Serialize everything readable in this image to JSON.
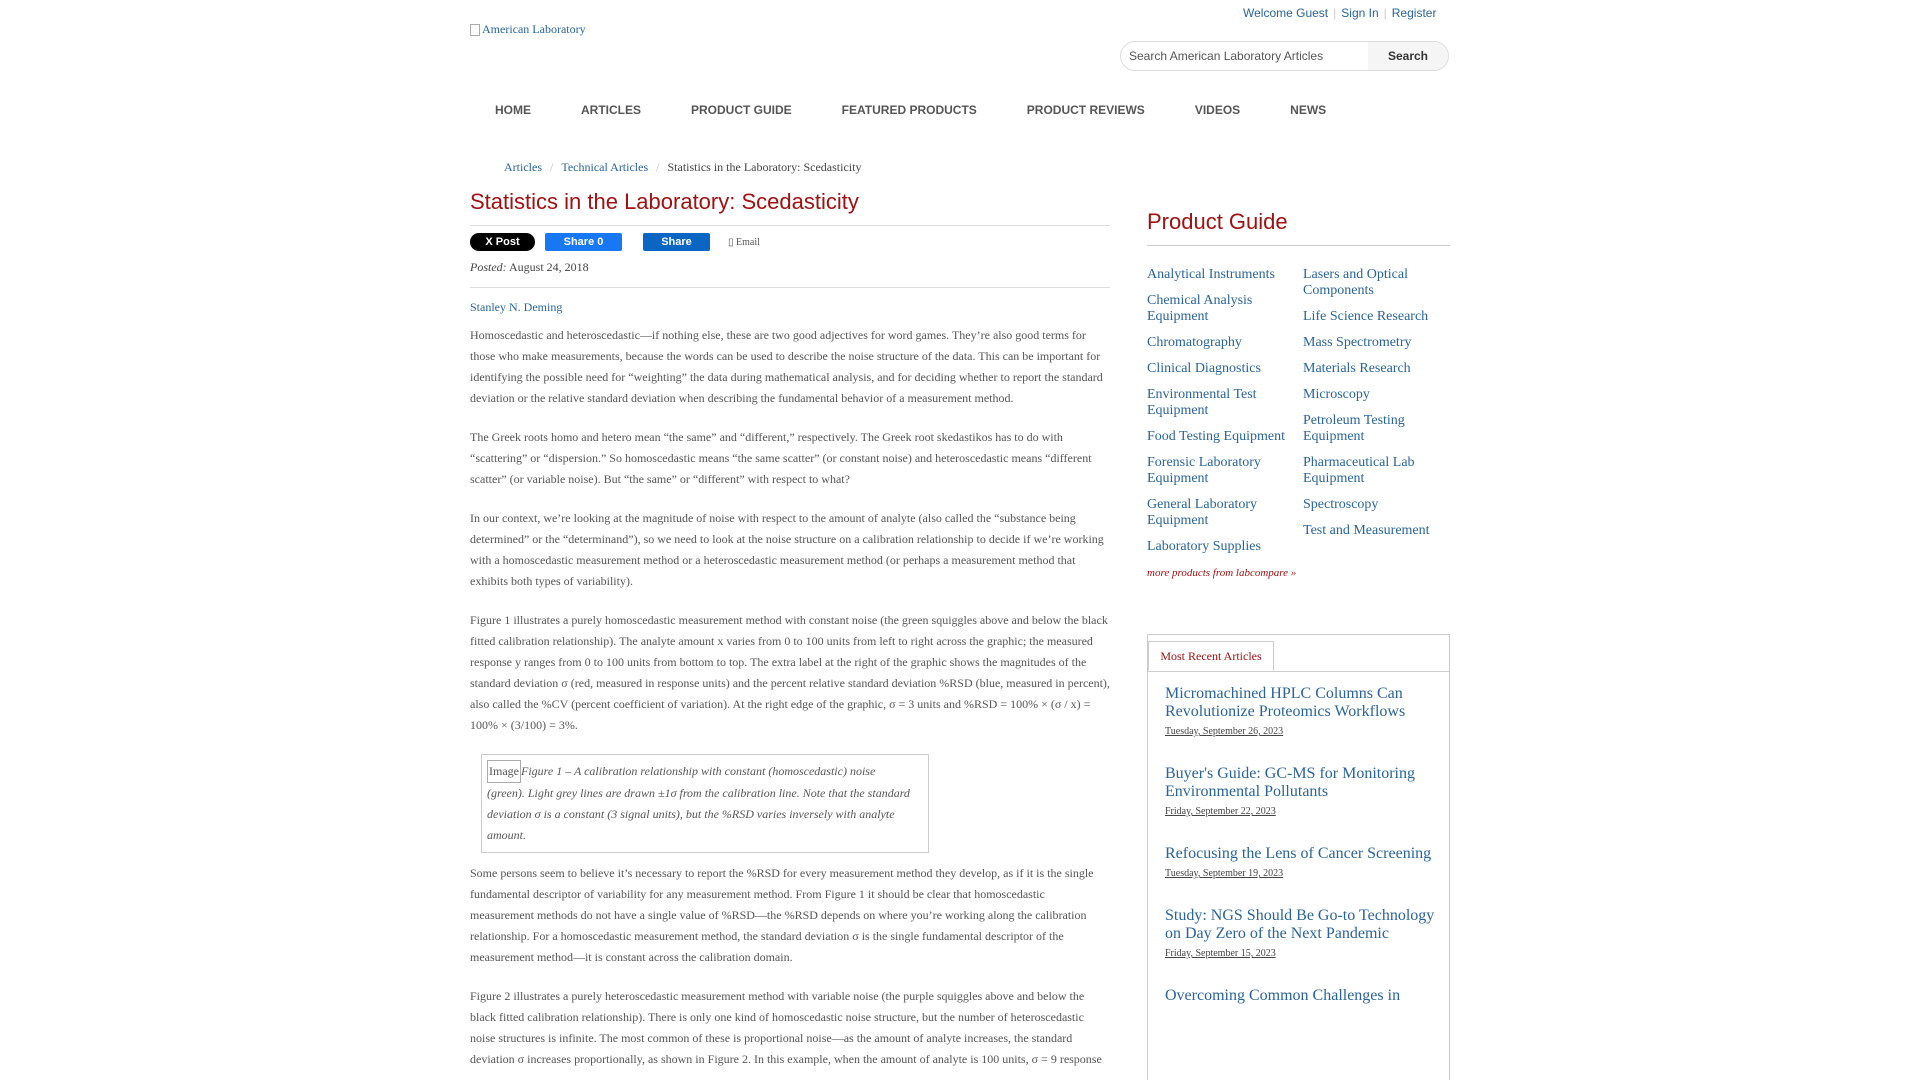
{
  "topbar": {
    "welcome": "Welcome Guest",
    "signin": "Sign In",
    "register": "Register"
  },
  "logo": {
    "alt": "American Laboratory"
  },
  "search": {
    "placeholder": "Search American Laboratory Articles",
    "button": "Search"
  },
  "nav": [
    "HOME",
    "ARTICLES",
    "PRODUCT GUIDE",
    "FEATURED PRODUCTS",
    "PRODUCT REVIEWS",
    "VIDEOS",
    "NEWS"
  ],
  "breadcrumb": {
    "items": [
      "Articles",
      "Technical Articles"
    ],
    "current": "Statistics in the Laboratory: Scedasticity"
  },
  "article": {
    "title": "Statistics in the Laboratory: Scedasticity",
    "share": {
      "x": "X Post",
      "fb": "Share 0",
      "linkedin": "Share",
      "email": "Email"
    },
    "posted_label": "Posted:",
    "posted_date": "August 24, 2018",
    "author": "Stanley N. Deming",
    "paragraphs": [
      "Homoscedastic and heteroscedastic—if nothing else, these are two good adjectives for word games. They’re also good terms for those who make measurements, because the words can be used to describe the noise structure of the data. This can be important for identifying the possible need for “weighting” the data during mathematical analysis, and for deciding whether to report the standard deviation or the relative standard deviation when describing the fundamental behavior of a measurement method.",
      "The Greek roots homo and hetero mean “the same” and “different,” respectively. The Greek root skedastikos has to do with “scattering” or “dispersion.” So homoscedastic means “the same scatter” (or constant noise) and heteroscedastic means “different scatter” (or variable noise). But “the same” or “different” with respect to what?",
      "In our context, we’re looking at the magnitude of noise with respect to the amount of analyte (also called the “substance being determined” or the “determinand”), so we need to look at the noise structure on a calibration relationship to decide if we’re working with a homoscedastic measurement method or a heteroscedastic measurement method (or perhaps a measurement method that exhibits both types of variability).",
      "Figure 1 illustrates a purely homoscedastic measurement method with constant noise (the green squiggles above and below the black fitted calibration relationship). The analyte amount x varies from 0 to 100 units from left to right across the graphic; the measured response y ranges from 0 to 100 units from bottom to top. The extra label at the right of the graphic shows the magnitudes of the standard deviation σ (red, measured in response units) and the percent relative standard deviation %RSD (blue, measured in percent), also called the %CV (percent coefficient of variation). At the right edge of the graphic, σ = 3 units and %RSD = 100% × (σ / x) = 100% × (3/100) = 3%."
    ],
    "figure_img": "Image",
    "figure_caption": "Figure 1 – A calibration relationship with constant (homoscedastic) noise (green). Light grey lines are drawn ±1σ from the calibration line. Note that the standard deviation σ is a constant (3 signal units), but the %RSD varies inversely with analyte amount.",
    "paragraphs2": [
      "Some persons seem to believe it’s necessary to report the %RSD for every measurement method they develop, as if it is the single fundamental descriptor of variability for any measurement method. From Figure 1 it should be clear that homoscedastic measurement methods do not have a single value of %RSD—the %RSD depends on where you’re working along the calibration relationship. For a homoscedastic measurement method, the standard deviation σ is the single fundamental descriptor of the measurement method—it is constant across the calibration domain.",
      "Figure 2 illustrates a purely heteroscedastic measurement method with variable noise (the purple squiggles above and below the black fitted calibration relationship). There is only one kind of homoscedastic noise structure, but the number of heteroscedastic noise structures is infinite. The most common of these is proportional noise—as the amount of analyte increases, the standard deviation σ increases proportionally, as shown in Figure 2. In this example, when the amount of analyte is 100 units, σ = 9 response"
    ]
  },
  "sidebar": {
    "title": "Product Guide",
    "col1": [
      "Analytical Instruments",
      "Chemical Analysis Equipment",
      "Chromatography",
      "Clinical Diagnostics",
      "Environmental Test Equipment",
      "Food Testing Equipment",
      "Forensic Laboratory Equipment",
      "General Laboratory Equipment",
      "Laboratory Supplies"
    ],
    "col2": [
      "Lasers and Optical Components",
      "Life Science Research",
      "Mass Spectrometry",
      "Materials Research",
      "Microscopy",
      "Petroleum Testing Equipment",
      "Pharmaceutical Lab Equipment",
      "Spectroscopy",
      "Test and Measurement"
    ],
    "more": "more products from labcompare »"
  },
  "recent": {
    "tab": "Most Recent Articles",
    "articles": [
      {
        "title": "Micromachined HPLC Columns Can Revolutionize Proteomics Workflows",
        "date": "Tuesday, September 26, 2023"
      },
      {
        "title": "Buyer's Guide: GC-MS for Monitoring Environmental Pollutants",
        "date": "Friday, September 22, 2023"
      },
      {
        "title": "Refocusing the Lens of Cancer Screening",
        "date": "Tuesday, September 19, 2023"
      },
      {
        "title": "Study: NGS Should Be Go-to Technology on Day Zero of the Next Pandemic",
        "date": "Friday, September 15, 2023"
      },
      {
        "title": "Overcoming Common Challenges in",
        "date": ""
      }
    ]
  }
}
